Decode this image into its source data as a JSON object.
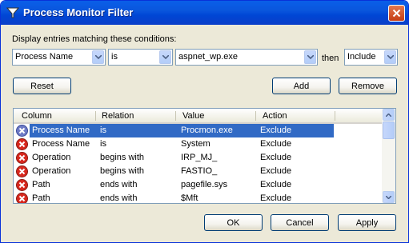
{
  "window": {
    "title": "Process Monitor Filter"
  },
  "filter": {
    "prompt": "Display entries matching these conditions:",
    "column_value": "Process Name",
    "relation_value": "is",
    "value_value": "aspnet_wp.exe",
    "then_label": "then",
    "action_value": "Include"
  },
  "buttons": {
    "reset": "Reset",
    "add": "Add",
    "remove": "Remove",
    "ok": "OK",
    "cancel": "Cancel",
    "apply": "Apply"
  },
  "table": {
    "headers": [
      "Column",
      "Relation",
      "Value",
      "Action"
    ],
    "rows": [
      {
        "column": "Process Name",
        "relation": "is",
        "value": "Procmon.exe",
        "action": "Exclude",
        "selected": true
      },
      {
        "column": "Process Name",
        "relation": "is",
        "value": "System",
        "action": "Exclude"
      },
      {
        "column": "Operation",
        "relation": "begins with",
        "value": "IRP_MJ_",
        "action": "Exclude"
      },
      {
        "column": "Operation",
        "relation": "begins with",
        "value": "FASTIO_",
        "action": "Exclude"
      },
      {
        "column": "Path",
        "relation": "ends with",
        "value": "pagefile.sys",
        "action": "Exclude"
      },
      {
        "column": "Path",
        "relation": "ends with",
        "value": "$Mft",
        "action": "Exclude"
      }
    ]
  },
  "icons": {
    "row_icon": "exclude-x-icon",
    "selected_row_icon": "exclude-x-icon-disabled"
  },
  "colors": {
    "title_bar": "#0a56dd",
    "selection": "#316ac5",
    "exclude_icon": "#d8281e"
  }
}
